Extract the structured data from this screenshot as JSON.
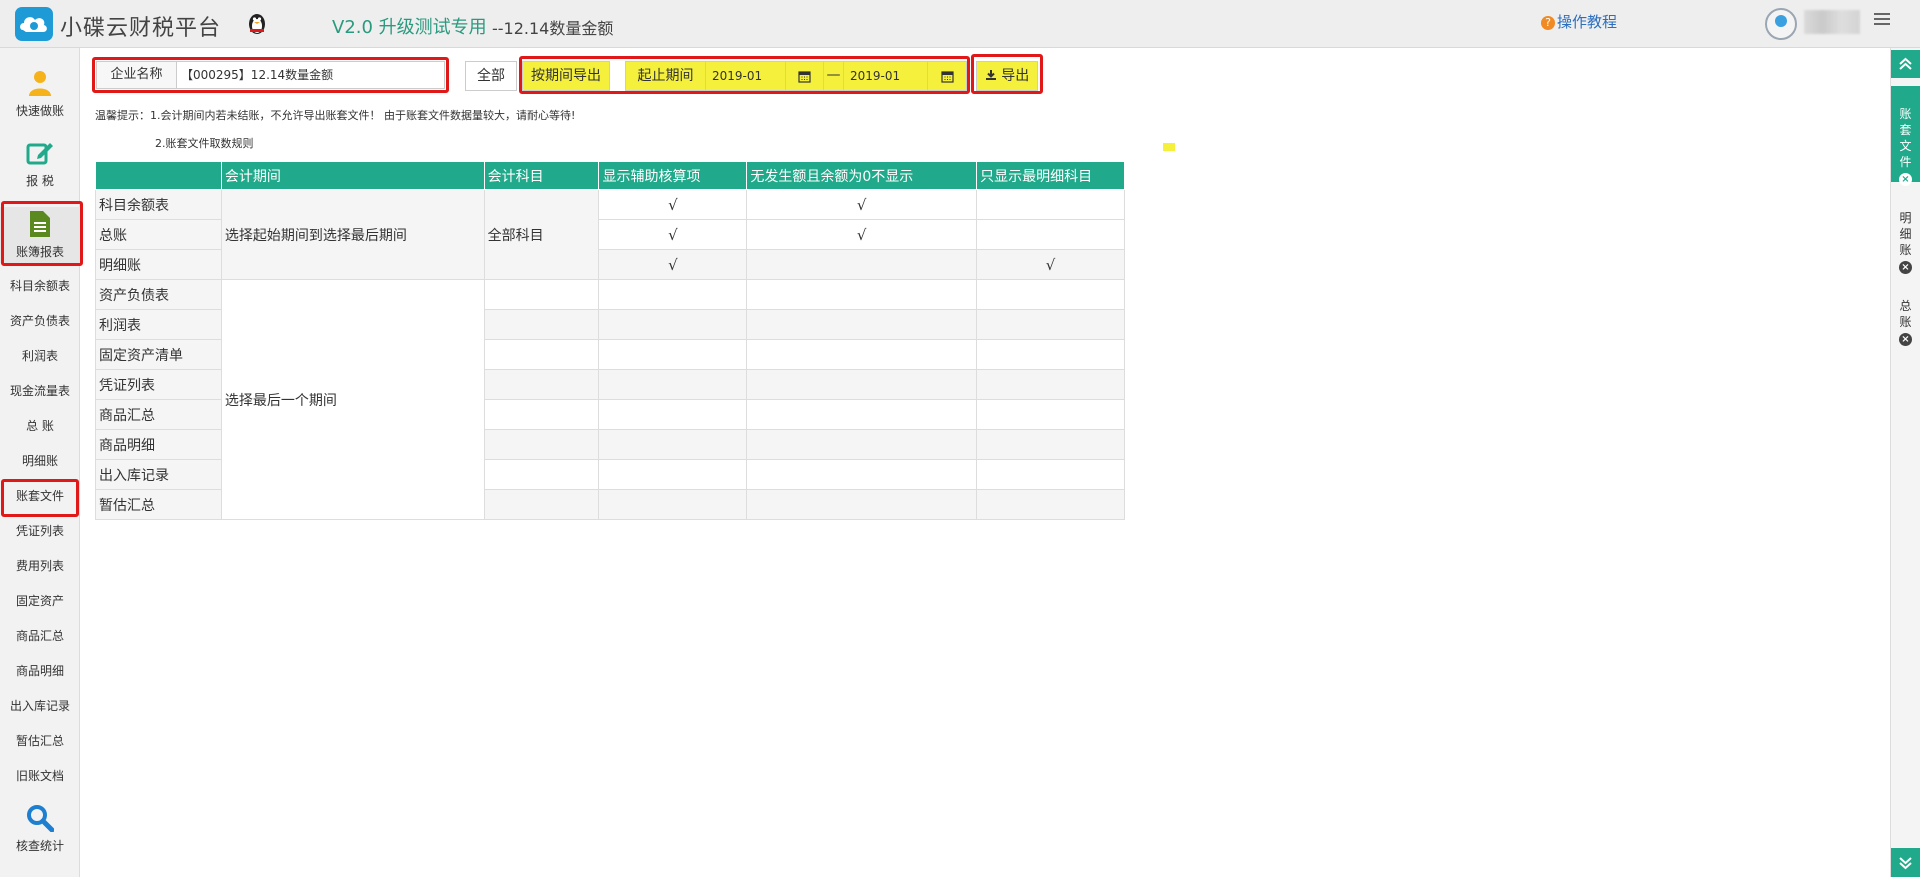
{
  "header": {
    "brand": "小碟云财税平台",
    "version": "V2.0 升级测试专用",
    "version_suffix": "--12.14数量金额",
    "help": "操作教程",
    "help_icon": "?"
  },
  "sidebar": {
    "quick": "快速做账",
    "tax": "报 税",
    "books": "账簿报表",
    "items": [
      "科目余额表",
      "资产负债表",
      "利润表",
      "现金流量表",
      "总 账",
      "明细账",
      "账套文件",
      "凭证列表",
      "费用列表",
      "固定资产",
      "商品汇总",
      "商品明细",
      "出入库记录",
      "暂估汇总",
      "旧账文档"
    ],
    "check": "核查统计"
  },
  "rightbar": {
    "tabs": [
      {
        "label": "账\n套\n文\n件",
        "close": "×"
      },
      {
        "label": "明\n细\n账",
        "close": "×"
      },
      {
        "label": "总\n账",
        "close": "×"
      }
    ]
  },
  "toolbar": {
    "company_label": "企业名称",
    "company_value": "【000295】12.14数量金额",
    "all_btn": "全部",
    "by_period_btn": "按期间导出",
    "period_label": "起止期间",
    "start": "2019-01",
    "dash": "—",
    "end": "2019-01",
    "export_btn": "导出"
  },
  "tips": {
    "line1": "温馨提示：1.会计期间内若未结账，不允许导出账套文件！   由于账套文件数据量较大，请耐心等待!",
    "line2": "2.账套文件取数规则"
  },
  "table": {
    "headers": [
      "",
      "会计期间",
      "会计科目",
      "显示辅助核算项",
      "无发生额且余额为0不显示",
      "只显示最明细科目"
    ],
    "group1_period": "选择起始期间到选择最后期间",
    "group1_subject": "全部科目",
    "group1_rows": [
      {
        "name": "科目余额表",
        "aux": "√",
        "nozero": "√",
        "detail": ""
      },
      {
        "name": "总账",
        "aux": "√",
        "nozero": "√",
        "detail": ""
      },
      {
        "name": "明细账",
        "aux": "√",
        "nozero": "",
        "detail": "√"
      }
    ],
    "group2_period": "选择最后一个期间",
    "group2_rows": [
      "资产负债表",
      "利润表",
      "固定资产清单",
      "凭证列表",
      "商品汇总",
      "商品明细",
      "出入库记录",
      "暂估汇总"
    ]
  },
  "colors": {
    "accent": "#20a98a",
    "highlight": "#f5f03c",
    "annotation_red": "#e01818"
  }
}
